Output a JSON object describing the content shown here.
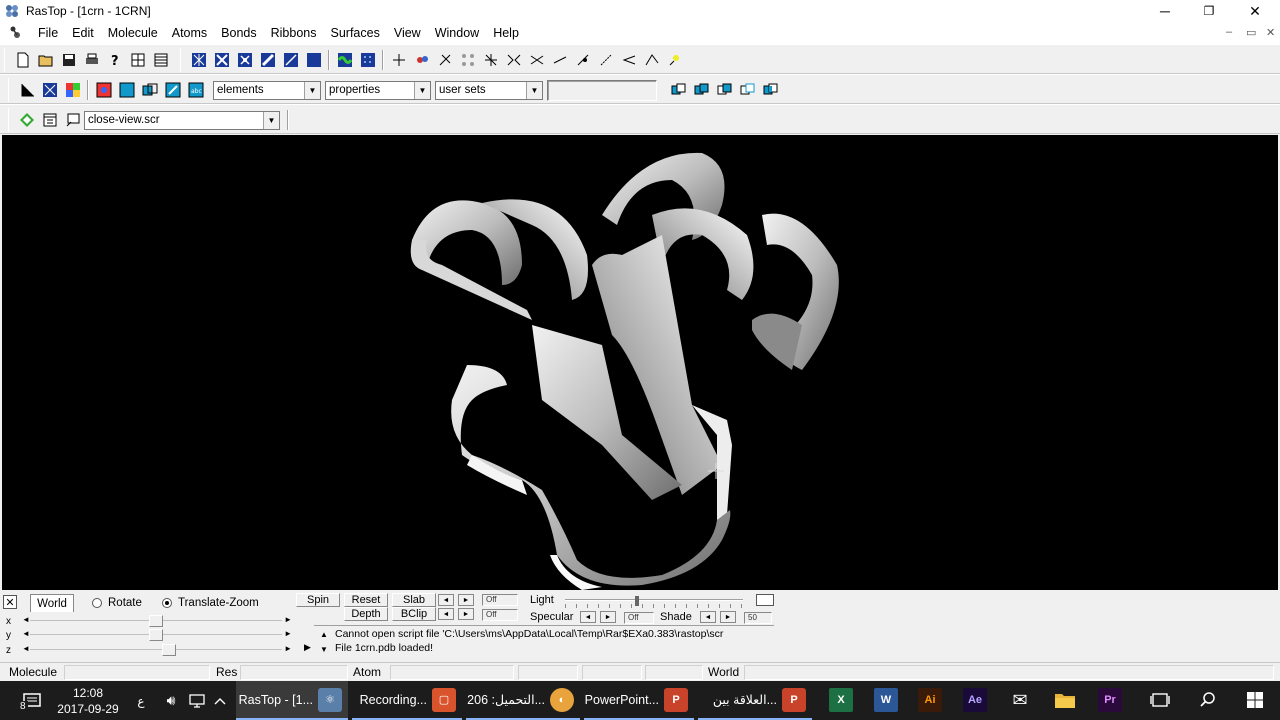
{
  "window": {
    "title": "RasTop - [1crn - 1CRN]",
    "controls": {
      "minimize": "─",
      "restore": "❐",
      "close": "✕"
    },
    "mdi_controls": {
      "minimize": "–",
      "restore": "▭",
      "close": "✕"
    }
  },
  "menubar": {
    "items": [
      "File",
      "Edit",
      "Molecule",
      "Atoms",
      "Bonds",
      "Ribbons",
      "Surfaces",
      "View",
      "Window",
      "Help"
    ]
  },
  "toolbar2": {
    "selectors": [
      {
        "value": "elements"
      },
      {
        "value": "properties"
      },
      {
        "value": "user sets"
      }
    ]
  },
  "toolbar3": {
    "script_select": "close-view.scr"
  },
  "panel": {
    "close": "✕",
    "tabs": {
      "world": "World",
      "rotate": "Rotate",
      "translate_zoom": "Translate-Zoom"
    },
    "axes": [
      {
        "label": "x",
        "value": 0.5
      },
      {
        "label": "y",
        "value": 0.5
      },
      {
        "label": "z",
        "value": 0.55
      }
    ],
    "arrows": {
      "left": "◄",
      "right": "►",
      "play": "▶"
    },
    "buttons": {
      "spin": "Spin",
      "reset": "Reset",
      "depth": "Depth",
      "slab": "Slab",
      "bclip": "BClip"
    },
    "off_labels": [
      "Off",
      "Off",
      "Off"
    ],
    "light": {
      "label": "Light",
      "specular": "Specular",
      "shade": "Shade",
      "shade_value": "50",
      "level": 0.4
    },
    "messages": [
      "Cannot open script file 'C:\\Users\\ms\\AppData\\Local\\Temp\\Rar$EXa0.383\\rastop\\scr",
      "File 1crn.pdb loaded!"
    ],
    "msg_arrows": {
      "up": "▲",
      "down": "▼"
    }
  },
  "statusbar": {
    "molecule": "Molecule",
    "res": "Res",
    "atom": "Atom",
    "world": "World"
  },
  "taskbar": {
    "notification_count": "8",
    "clock_time": "12:08",
    "clock_date": "2017-09-29",
    "lang": "ع",
    "running": [
      {
        "label": "RasTop - [1...",
        "name": "rastop",
        "color": "#5a7fa8"
      },
      {
        "label": "Recording...",
        "name": "recording",
        "color": "#d9532c"
      },
      {
        "label": "التحميل: 206...",
        "name": "download",
        "color": "#e8a33c"
      },
      {
        "label": "PowerPoint...",
        "name": "powerpoint",
        "color": "#c8432a"
      },
      {
        "label": "العلاقة بين...",
        "name": "powerpoint-2",
        "color": "#c8432a"
      }
    ],
    "pinned": [
      {
        "name": "excel-icon",
        "text": "X",
        "color": "#1d7044"
      },
      {
        "name": "word-icon",
        "text": "W",
        "color": "#2b5797"
      },
      {
        "name": "illustrator-icon",
        "text": "Ai",
        "color": "#3a1a08",
        "fg": "#ff9a00"
      },
      {
        "name": "after-effects-icon",
        "text": "Ae",
        "color": "#1a0a3a",
        "fg": "#b5a6ff"
      },
      {
        "name": "mail-icon",
        "text": "✉",
        "color": "#1c1c1c",
        "fg": "#ffffff"
      },
      {
        "name": "file-explorer-icon",
        "text": "",
        "color": "#e8b339"
      },
      {
        "name": "premiere-icon",
        "text": "Pr",
        "color": "#2a0a3a",
        "fg": "#e08cff"
      },
      {
        "name": "task-view-icon",
        "text": "▭",
        "color": "#1c1c1c",
        "fg": "#ffffff"
      },
      {
        "name": "search-icon",
        "text": "⌕",
        "color": "#1c1c1c",
        "fg": "#ffffff"
      },
      {
        "name": "start-icon",
        "text": "⊞",
        "color": "#1c1c1c",
        "fg": "#ffffff"
      }
    ]
  }
}
